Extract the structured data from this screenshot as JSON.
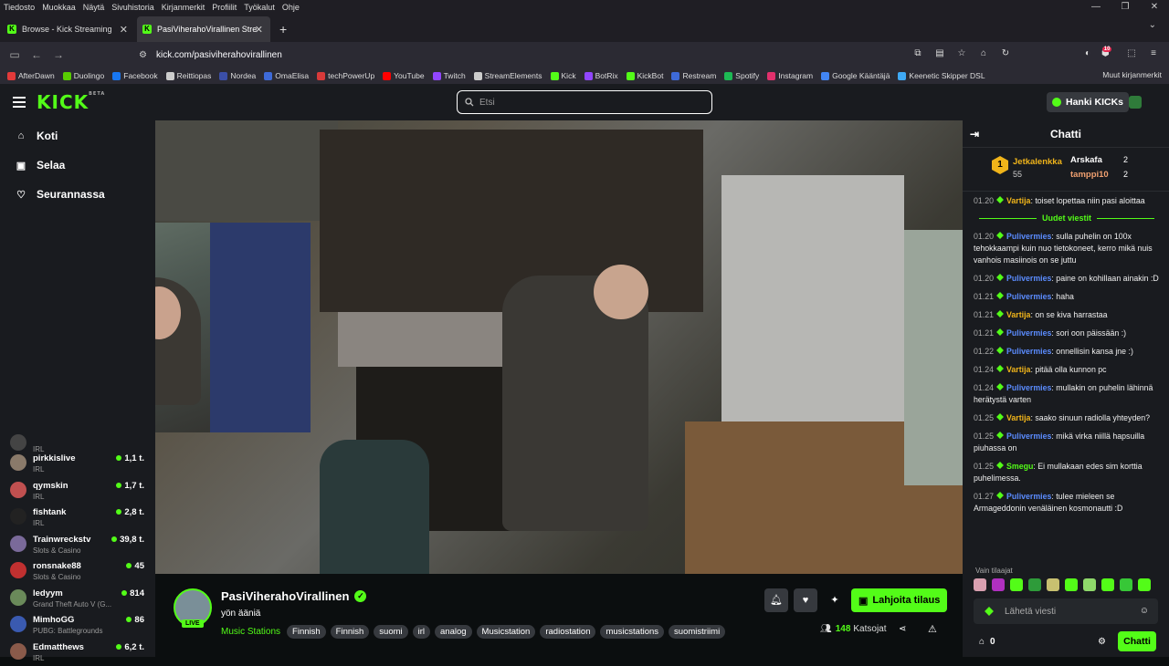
{
  "menubar": [
    "Tiedosto",
    "Muokkaa",
    "Näytä",
    "Sivuhistoria",
    "Kirjanmerkit",
    "Profiilit",
    "Työkalut",
    "Ohje"
  ],
  "tabs": [
    {
      "title": "Browse - Kick Streaming"
    },
    {
      "title": "PasiViherahoVirallinen Stre"
    }
  ],
  "url": "kick.com/pasiviherahovirallinen",
  "notification_count": "10",
  "bookmarks": [
    {
      "label": "AfterDawn",
      "color": "#e23a3a"
    },
    {
      "label": "Duolingo",
      "color": "#58cc02"
    },
    {
      "label": "Facebook",
      "color": "#1877f2"
    },
    {
      "label": "Reittiopas",
      "color": "#cccccc"
    },
    {
      "label": "Nordea",
      "color": "#3b4fa8"
    },
    {
      "label": "OmaElisa",
      "color": "#3e6ad8"
    },
    {
      "label": "techPowerUp",
      "color": "#d83a3a"
    },
    {
      "label": "YouTube",
      "color": "#ff0000"
    },
    {
      "label": "Twitch",
      "color": "#9146ff"
    },
    {
      "label": "StreamElements",
      "color": "#cccccc"
    },
    {
      "label": "Kick",
      "color": "#53fc18"
    },
    {
      "label": "BotRix",
      "color": "#9146ff"
    },
    {
      "label": "KickBot",
      "color": "#53fc18"
    },
    {
      "label": "Restream",
      "color": "#3e6ad8"
    },
    {
      "label": "Spotify",
      "color": "#1db954"
    },
    {
      "label": "Instagram",
      "color": "#e1306c"
    },
    {
      "label": "Google Kääntäjä",
      "color": "#4285f4"
    },
    {
      "label": "Keenetic Skipper DSL",
      "color": "#3fa9f5"
    }
  ],
  "bookmarks_right": "Muut kirjanmerkit",
  "kick": {
    "logo": "KICK",
    "logo_sup": "BETA",
    "search_placeholder": "Etsi",
    "get_kicks": "Hanki KICKs"
  },
  "nav": [
    {
      "label": "Koti",
      "icon": "home-icon"
    },
    {
      "label": "Selaa",
      "icon": "browse-icon"
    },
    {
      "label": "Seurannassa",
      "icon": "heart-icon"
    }
  ],
  "channels": [
    {
      "name": "",
      "category": "IRL",
      "viewers": "",
      "color": "#444"
    },
    {
      "name": "pirkkislive",
      "category": "IRL",
      "viewers": "1,1 t.",
      "color": "#8a7a6a"
    },
    {
      "name": "qymskin",
      "category": "IRL",
      "viewers": "1,7 t.",
      "color": "#c05050"
    },
    {
      "name": "fishtank",
      "category": "IRL",
      "viewers": "2,8 t.",
      "color": "#222"
    },
    {
      "name": "Trainwreckstv",
      "category": "Slots & Casino",
      "viewers": "39,8 t.",
      "color": "#7a6a9a"
    },
    {
      "name": "ronsnake88",
      "category": "Slots & Casino",
      "viewers": "45",
      "color": "#c03030"
    },
    {
      "name": "ledyym",
      "category": "Grand Theft Auto V (G...",
      "viewers": "814",
      "color": "#6a8a5a"
    },
    {
      "name": "MimhoGG",
      "category": "PUBG: Battlegrounds",
      "viewers": "86",
      "color": "#3a5ab0"
    },
    {
      "name": "Edmatthews",
      "category": "IRL",
      "viewers": "6,2 t.",
      "color": "#8a5a4a"
    }
  ],
  "stream": {
    "channel": "PasiViherahoVirallinen",
    "live": "LIVE",
    "title": "yön ääniä",
    "category": "Music Stations",
    "tags": [
      "Finnish",
      "Finnish",
      "suomi",
      "irl",
      "analog",
      "Musicstation",
      "radiostation",
      "musicstations",
      "suomistriimi"
    ],
    "subscribe": "Lahjoita tilaus",
    "viewers": "148",
    "viewers_label": "Katsojat"
  },
  "chat": {
    "title": "Chatti",
    "leader1": {
      "rank": "1",
      "name": "Jetkalenkka",
      "value": "55"
    },
    "leader2": {
      "name": "Arskafa",
      "value": "2"
    },
    "leader3": {
      "name": "tamppi10",
      "value": "2"
    },
    "new_messages": "Uudet viestit",
    "messages_before": [
      {
        "time": "01.20",
        "user": "Vartija",
        "color": "#f0b41a",
        "text": "toiset lopettaa niin pasi aloittaa"
      }
    ],
    "messages": [
      {
        "time": "01.20",
        "user": "Pulivermies",
        "color": "#5b8cff",
        "text": "sulla puhelin on 100x tehokkaampi kuin nuo tietokoneet, kerro mikä nuis vanhois masiinois on se juttu"
      },
      {
        "time": "01.20",
        "user": "Pulivermies",
        "color": "#5b8cff",
        "text": "paine on kohillaan ainakin :D"
      },
      {
        "time": "01.21",
        "user": "Pulivermies",
        "color": "#5b8cff",
        "text": "haha"
      },
      {
        "time": "01.21",
        "user": "Vartija",
        "color": "#f0b41a",
        "text": "on se kiva harrastaa"
      },
      {
        "time": "01.21",
        "user": "Pulivermies",
        "color": "#5b8cff",
        "text": "sori oon päissään :)"
      },
      {
        "time": "01.22",
        "user": "Pulivermies",
        "color": "#5b8cff",
        "text": "onnellisin kansa jne :)"
      },
      {
        "time": "01.24",
        "user": "Vartija",
        "color": "#f0b41a",
        "text": "pitää olla kunnon pc"
      },
      {
        "time": "01.24",
        "user": "Pulivermies",
        "color": "#5b8cff",
        "text": "mullakin on puhelin lähinnä herätystä varten"
      },
      {
        "time": "01.25",
        "user": "Vartija",
        "color": "#f0b41a",
        "text": "saako sinuun radiolla yhteyden?"
      },
      {
        "time": "01.25",
        "user": "Pulivermies",
        "color": "#5b8cff",
        "text": "mikä virka niillä hapsuilla piuhassa on"
      },
      {
        "time": "01.25",
        "user": "Smegu",
        "color": "#53fc18",
        "text": "Ei mullakaan edes sim korttia puhelimessa."
      },
      {
        "time": "01.27",
        "user": "Pulivermies",
        "color": "#5b8cff",
        "text": "tulee mieleen se Armageddonin venäläinen kosmonautti :D"
      }
    ],
    "subs_only": "Vain tilaajat",
    "input_placeholder": "Lähetä viesti",
    "points": "0",
    "send": "Chatti"
  }
}
